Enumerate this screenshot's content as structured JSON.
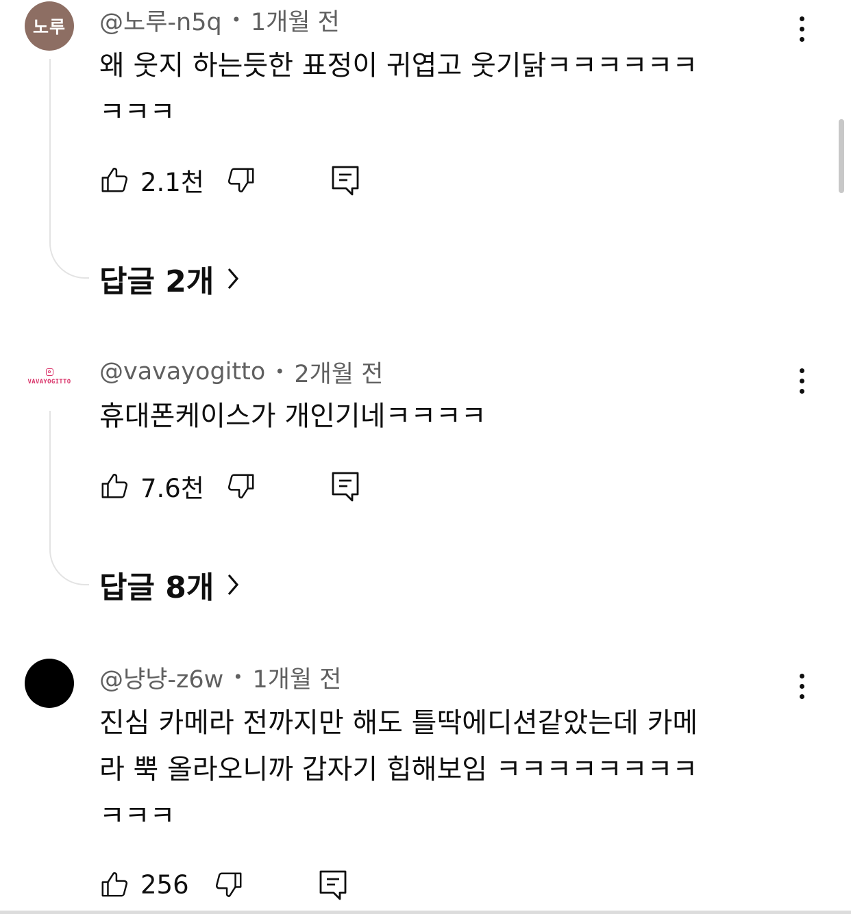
{
  "comments": [
    {
      "avatar_text": "노루",
      "avatar_color": "#8d6e63",
      "author": "@노루-n5q",
      "time": "1개월 전",
      "text": "왜 웃지 하는듯한 표정이 귀엽고 웃기닭ㅋㅋㅋㅋㅋㅋ\nㅋㅋㅋ",
      "likes": "2.1천",
      "replies_label": "답글 2개"
    },
    {
      "avatar_brand_text": "VAVAYOGITTO",
      "avatar_color": "#ffffff",
      "author": "@vavayogitto",
      "time": "2개월 전",
      "text": "휴대폰케이스가 개인기네ㅋㅋㅋㅋ",
      "likes": "7.6천",
      "replies_label": "답글 8개"
    },
    {
      "avatar_color": "#000000",
      "author": "@냥냥-z6w",
      "time": "1개월 전",
      "text": "진심 카메라 전까지만 해도 틀딱에디션같았는데 카메\n라 뿍 올라오니까 갑자기 힙해보임 ㅋㅋㅋㅋㅋㅋㅋㅋ\nㅋㅋㅋ",
      "likes": "256"
    }
  ],
  "icons": {
    "like": "thumbs-up-icon",
    "dislike": "thumbs-down-icon",
    "reply": "comment-reply-icon",
    "more": "more-vertical-icon",
    "chevron": "chevron-right-icon"
  },
  "colors": {
    "text": "#0f0f0f",
    "meta": "#606060",
    "thread_line": "#e3e3e3"
  }
}
